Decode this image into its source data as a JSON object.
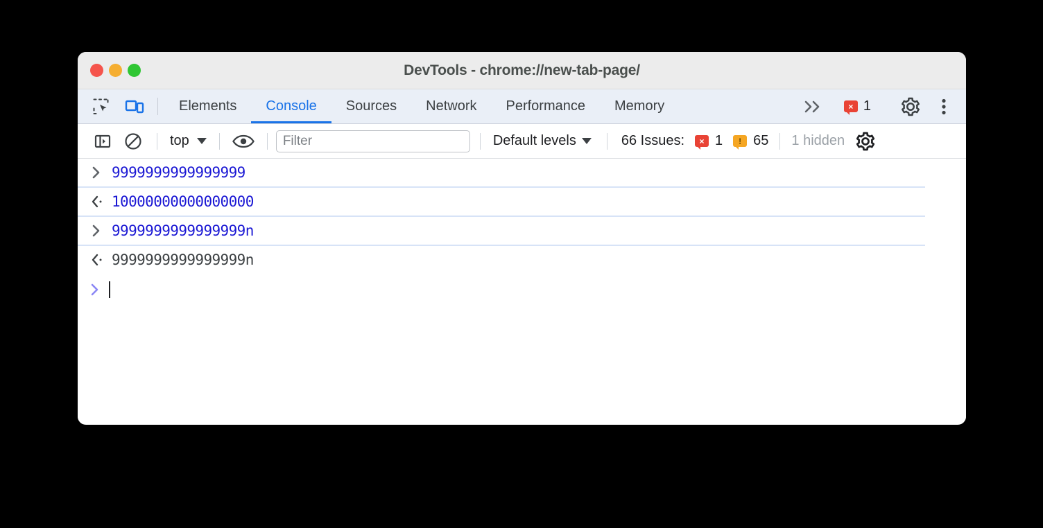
{
  "window": {
    "title": "DevTools - chrome://new-tab-page/",
    "traffic_lights": [
      {
        "name": "close",
        "color": "#f5544c"
      },
      {
        "name": "minimize",
        "color": "#f5ae31"
      },
      {
        "name": "maximize",
        "color": "#2fc633"
      }
    ]
  },
  "tabbar": {
    "inspect_icon": "inspect-element-icon",
    "device_icon": "device-toolbar-icon",
    "tabs": [
      {
        "label": "Elements",
        "active": false
      },
      {
        "label": "Console",
        "active": true
      },
      {
        "label": "Sources",
        "active": false
      },
      {
        "label": "Network",
        "active": false
      },
      {
        "label": "Performance",
        "active": false
      },
      {
        "label": "Memory",
        "active": false
      }
    ],
    "more_tabs_icon": "double-chevron-right-icon",
    "error_badge": {
      "icon": "error-badge-icon",
      "glyph": "×",
      "count": "1",
      "color": "#e94335"
    },
    "settings_icon": "gear-icon",
    "more_options_icon": "kebab-menu-icon"
  },
  "console_toolbar": {
    "sidebar_toggle_icon": "show-console-sidebar-icon",
    "clear_icon": "clear-console-icon",
    "context_selector": {
      "label": "top",
      "caret": "chevron-down-icon"
    },
    "eye_icon": "live-expression-eye-icon",
    "filter": {
      "value": "",
      "placeholder": "Filter"
    },
    "levels_selector": {
      "label": "Default levels",
      "caret": "chevron-down-icon"
    },
    "issues": {
      "label": "66 Issues:",
      "error_icon": "error-badge-icon",
      "error_glyph": "×",
      "error_count": "1",
      "warning_icon": "warning-badge-icon",
      "warning_glyph": "!",
      "warning_count": "65"
    },
    "hidden_label": "1 hidden",
    "settings_icon": "console-settings-gear-icon"
  },
  "console": {
    "messages": [
      {
        "gutter": "input-chevron-icon",
        "kind": "input",
        "text": "9999999999999999"
      },
      {
        "gutter": "output-arrow-icon",
        "kind": "output",
        "text": "10000000000000000"
      },
      {
        "gutter": "input-chevron-icon",
        "kind": "input",
        "text": "9999999999999999n"
      },
      {
        "gutter": "output-arrow-icon",
        "kind": "plain",
        "text": "9999999999999999n"
      }
    ],
    "prompt": {
      "gutter": "prompt-chevron-icon",
      "value": ""
    }
  },
  "colors": {
    "accent": "#1a73e8",
    "input_text": "#1a17d4",
    "error": "#e94335",
    "warning": "#f5a623",
    "separator": "#d7e3f7",
    "muted": "#9aa0a6"
  }
}
